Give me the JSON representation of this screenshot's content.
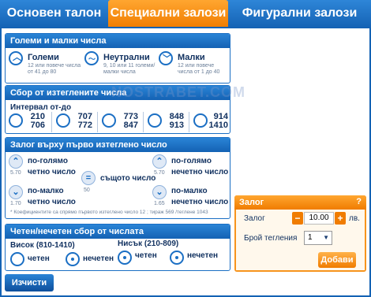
{
  "tabs": [
    "Основен талон",
    "Специални залози",
    "Фигурални залози"
  ],
  "section1": {
    "title": "Големи и малки числа",
    "options": [
      {
        "label": "Големи",
        "desc": "12 или повече числа от 41 до 80"
      },
      {
        "label": "Неутрални",
        "desc": "9, 10 или 11 големи/малки числа"
      },
      {
        "label": "Малки",
        "desc": "12 или повече числа от 1 до 40"
      }
    ]
  },
  "section2": {
    "title": "Сбор от изтеглените числа",
    "interval_label": "Интервал от-до",
    "ranges": [
      {
        "from": "210",
        "to": "706"
      },
      {
        "from": "707",
        "to": "772"
      },
      {
        "from": "773",
        "to": "847"
      },
      {
        "from": "848",
        "to": "913"
      },
      {
        "from": "914",
        "to": "1410"
      }
    ]
  },
  "section3": {
    "title": "Залог върху първо изтеглено число",
    "options": [
      {
        "line1": "по-голямо",
        "line2": "четно число",
        "coef": "5.70"
      },
      {
        "line1": "същото число",
        "line2": "",
        "coef": "50"
      },
      {
        "line1": "по-голямо",
        "line2": "нечетно число",
        "coef": "5.70"
      },
      {
        "line1": "по-малко",
        "line2": "четно число",
        "coef": "1.70"
      },
      {
        "line1": "по-малко",
        "line2": "нечетно число",
        "coef": "1.65"
      }
    ],
    "footnote": "* Коефициентите са спрямо първото изтеглено число 12 ; тираж 569 /теглене 1043"
  },
  "section4": {
    "title": "Четен/нечетен сбор от числата",
    "high": "Висок (810-1410)",
    "low": "Нисък (210-809)",
    "even": "четен",
    "odd": "нечетен"
  },
  "bet": {
    "title": "Залог",
    "help": "?",
    "stake_label": "Залог",
    "stake_value": "10.00",
    "currency": "лв.",
    "draws_label": "Брой тегления",
    "draws_value": "1",
    "add_label": "Добави"
  },
  "clear_label": "Изчисти",
  "watermark": "NOSTRABET.COM"
}
